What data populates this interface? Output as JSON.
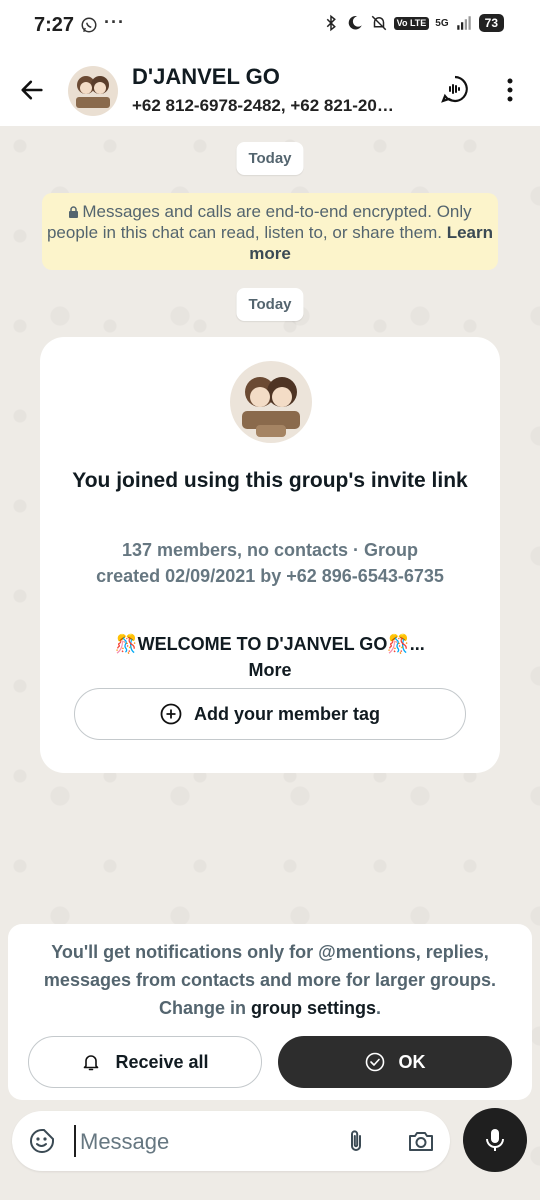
{
  "status_bar": {
    "time": "7:27",
    "more": "···",
    "network": "5G",
    "volte": "Vo LTE",
    "battery": "73"
  },
  "header": {
    "title": "D'JANVEL GO",
    "subtitle": "+62 812-6978-2482, +62 821-20…"
  },
  "chat": {
    "date_label_1": "Today",
    "encryption_notice": "Messages and calls are end-to-end encrypted. Only people in this chat can read, listen to, or share them.",
    "encryption_learn_more": "Learn more",
    "date_label_2": "Today"
  },
  "group_card": {
    "title": "You joined using this group's invite link",
    "meta": "137 members, no contacts · Group created 02/09/2021 by +62 896-6543-6735",
    "description": "🎊WELCOME TO D'JANVEL GO🎊...",
    "more": "More",
    "member_tag_button": "Add your member tag"
  },
  "notification_sheet": {
    "text": "You'll get notifications only for @mentions, replies, messages from contacts and more for larger groups. Change in",
    "link": "group settings",
    "suffix": ".",
    "receive_all_button": "Receive all",
    "ok_button": "OK"
  },
  "composer": {
    "placeholder": "Message"
  },
  "colors": {
    "accent_dark": "#2d2d2d",
    "notice_bg": "#fcf4cb",
    "wallpaper": "#eeebe6"
  },
  "icons": [
    "whatsapp-icon",
    "bluetooth-icon",
    "moon-icon",
    "mute-icon",
    "signal-icon",
    "back-arrow-icon",
    "voice-chat-icon",
    "more-vert-icon",
    "lock-icon",
    "plus-circle-icon",
    "bell-icon",
    "check-circle-icon",
    "sticker-icon",
    "paperclip-icon",
    "camera-icon",
    "mic-icon"
  ]
}
